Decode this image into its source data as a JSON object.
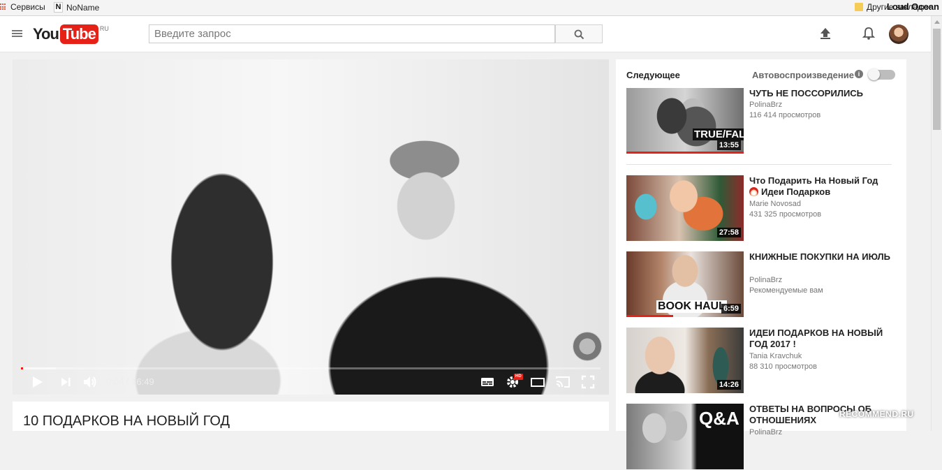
{
  "bookmarks_bar": {
    "apps_label": "Сервисы",
    "noname_label": "NoName",
    "other_bookmarks_label": "Другие закладки",
    "profile_name": "Loud Ocean"
  },
  "masthead": {
    "logo_you": "You",
    "logo_tube": "Tube",
    "logo_region": "RU",
    "search_placeholder": "Введите запрос",
    "search_value": ""
  },
  "player": {
    "time_current": "0:04",
    "time_total": "16:49",
    "time_display": "0:04 / 16:49",
    "progress_fraction": 0.004,
    "buffered_fraction": 0.06,
    "hd_badge": "HD"
  },
  "video": {
    "title": "10 ПОДАРКОВ НА НОВЫЙ ГОД"
  },
  "sidebar": {
    "up_next_label": "Следующее",
    "autoplay_label": "Автовоспроизведение",
    "autoplay_on": false,
    "items": [
      {
        "title": "ЧУТЬ НЕ ПОССОРИЛИСЬ",
        "channel": "PolinaBrz",
        "meta": "116 414 просмотров",
        "duration": "13:55",
        "thumb_text": "TRUE/FALSE",
        "watched_fraction": 1.0
      },
      {
        "title": "Что Подарить На Новый Год",
        "title_line2": "Идеи Подарков",
        "channel": "Marie Novosad",
        "meta": "431 325 просмотров",
        "duration": "27:58",
        "thumb_text": "",
        "watched_fraction": 0.0
      },
      {
        "title": "КНИЖНЫЕ ПОКУПКИ НА ИЮЛЬ",
        "channel": "PolinaBrz",
        "meta": "Рекомендуемые вам",
        "duration": "6:59",
        "thumb_text": "BOOK HAUL",
        "watched_fraction": 0.4
      },
      {
        "title": "ИДЕИ ПОДАРКОВ НА НОВЫЙ ГОД 2017 !",
        "channel": "Tania Kravchuk",
        "meta": "88 310 просмотров",
        "duration": "14:26",
        "thumb_text": "",
        "watched_fraction": 0.0
      },
      {
        "title": "ОТВЕТЫ НА ВОПРОСЫ ОБ ОТНОШЕНИЯХ",
        "channel": "PolinaBrz",
        "meta": "",
        "duration": "",
        "thumb_text": "Q&A",
        "watched_fraction": 0.0
      }
    ]
  },
  "watermark_text": "RECOMMEND.RU",
  "colors": {
    "brand_red": "#e62117",
    "page_bg": "#f1f1f1"
  }
}
